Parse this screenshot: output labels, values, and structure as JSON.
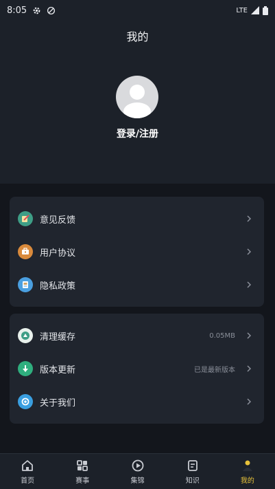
{
  "status": {
    "time": "8:05",
    "network": "LTE"
  },
  "header": {
    "title": "我的",
    "login_label": "登录/注册"
  },
  "menu_group_1": [
    {
      "label": "意见反馈",
      "icon": "feedback-icon",
      "color": "#3e9e86"
    },
    {
      "label": "用户协议",
      "icon": "agreement-icon",
      "color": "#d98a3c"
    },
    {
      "label": "隐私政策",
      "icon": "privacy-icon",
      "color": "#4a9fe0"
    }
  ],
  "menu_group_2": [
    {
      "label": "清理缓存",
      "value": "0.05MB",
      "icon": "clear-cache-icon",
      "color": "#3e9e86"
    },
    {
      "label": "版本更新",
      "value": "已是最新版本",
      "icon": "update-icon",
      "color": "#2fae7e"
    },
    {
      "label": "关于我们",
      "value": "",
      "icon": "about-icon",
      "color": "#3a9fe0"
    }
  ],
  "tabs": [
    {
      "label": "首页",
      "icon": "home-icon",
      "active": false
    },
    {
      "label": "赛事",
      "icon": "events-icon",
      "active": false
    },
    {
      "label": "集锦",
      "icon": "highlights-icon",
      "active": false
    },
    {
      "label": "知识",
      "icon": "knowledge-icon",
      "active": false
    },
    {
      "label": "我的",
      "icon": "profile-icon",
      "active": true
    }
  ],
  "colors": {
    "accent": "#e8c23a",
    "background": "#13161c",
    "card": "#20252e",
    "header": "#1c2129"
  }
}
